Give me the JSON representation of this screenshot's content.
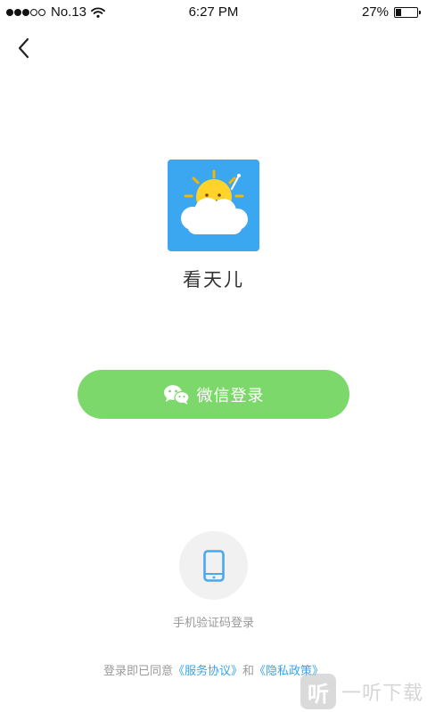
{
  "status_bar": {
    "carrier": "No.13",
    "time": "6:27 PM",
    "battery": "27%",
    "signal_dots_filled": 3,
    "signal_dots_total": 5,
    "battery_level": 0.27,
    "wifi_icon": "wifi-icon"
  },
  "nav": {
    "back_icon": "chevron-left-icon"
  },
  "app": {
    "name": "看天儿",
    "logo_icon": "sun-on-cloud-logo",
    "logo_bg_color": "#3aa7f0"
  },
  "login": {
    "wechat_label": "微信登录",
    "wechat_icon": "wechat-icon",
    "wechat_color": "#7cd86a",
    "phone_label": "手机验证码登录",
    "phone_icon": "smartphone-icon",
    "phone_icon_color": "#4aa8ee"
  },
  "agreement": {
    "prefix": "登录即已同意",
    "service_link": "《服务协议》",
    "conjunction": "和",
    "privacy_link": "《隐私政策》",
    "link_color": "#35a4f0"
  },
  "watermark": {
    "glyph": "听",
    "text": "一听下载"
  }
}
